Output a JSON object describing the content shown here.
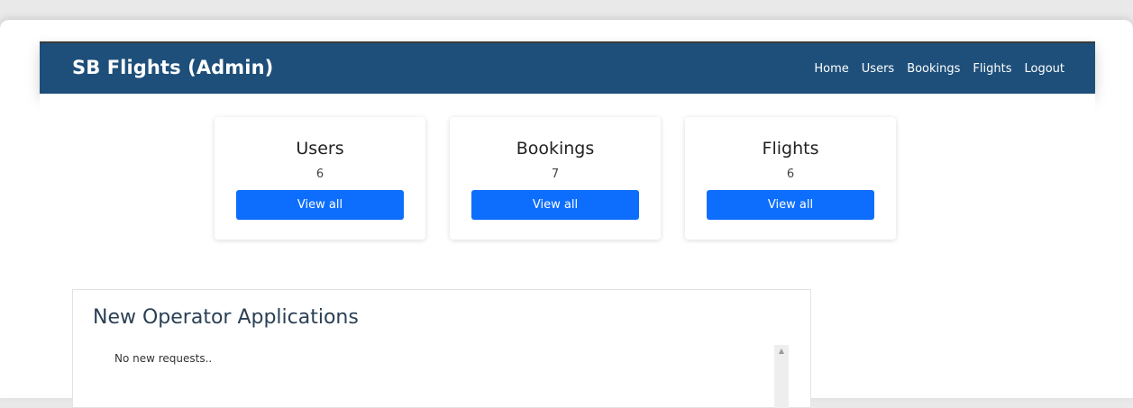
{
  "navbar": {
    "brand": "SB Flights (Admin)",
    "links": [
      "Home",
      "Users",
      "Bookings",
      "Flights",
      "Logout"
    ]
  },
  "cards": [
    {
      "title": "Users",
      "count": "6",
      "button": "View all"
    },
    {
      "title": "Bookings",
      "count": "7",
      "button": "View all"
    },
    {
      "title": "Flights",
      "count": "6",
      "button": "View all"
    }
  ],
  "applications": {
    "title": "New Operator Applications",
    "empty_text": "No new requests.."
  },
  "colors": {
    "navbar_bg": "#1e4f7a",
    "button_bg": "#0d6efd"
  }
}
